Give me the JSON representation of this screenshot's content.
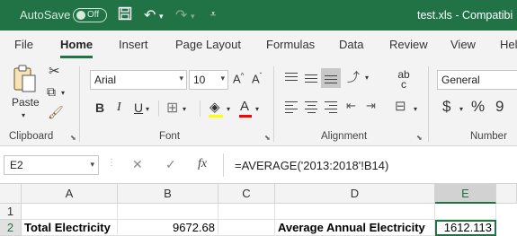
{
  "titlebar": {
    "autosave_label": "AutoSave",
    "autosave_state": "Off",
    "doc_title": "test.xls  -  Compatibi"
  },
  "tabs": [
    "File",
    "Home",
    "Insert",
    "Page Layout",
    "Formulas",
    "Data",
    "Review",
    "View",
    "Hel"
  ],
  "active_tab": "Home",
  "ribbon": {
    "clipboard": {
      "paste_label": "Paste",
      "group_label": "Clipboard"
    },
    "font": {
      "font_name": "Arial",
      "font_size": "10",
      "group_label": "Font",
      "bold": "B",
      "italic": "I",
      "underline": "U",
      "grow": "A^",
      "shrink": "Aˇ",
      "font_color": "A"
    },
    "alignment": {
      "group_label": "Alignment",
      "wrap": "ab\nc"
    },
    "number": {
      "format": "General",
      "group_label": "Number",
      "currency": "$",
      "percent": "%",
      "comma": "9"
    }
  },
  "formula_bar": {
    "name_box": "E2",
    "formula": "=AVERAGE('2013:2018'!B14)",
    "cancel": "✕",
    "enter": "✓",
    "fx": "fx"
  },
  "columns": [
    "A",
    "B",
    "C",
    "D",
    "E"
  ],
  "selected_column": "E",
  "rows": [
    {
      "number": "1",
      "cells": [
        "",
        "",
        "",
        "",
        ""
      ]
    },
    {
      "number": "2",
      "cells": [
        "Total Electricity",
        "9672.68",
        "",
        "Average Annual Electricity",
        "1612.113"
      ]
    }
  ],
  "colors": {
    "accent": "#217346"
  }
}
